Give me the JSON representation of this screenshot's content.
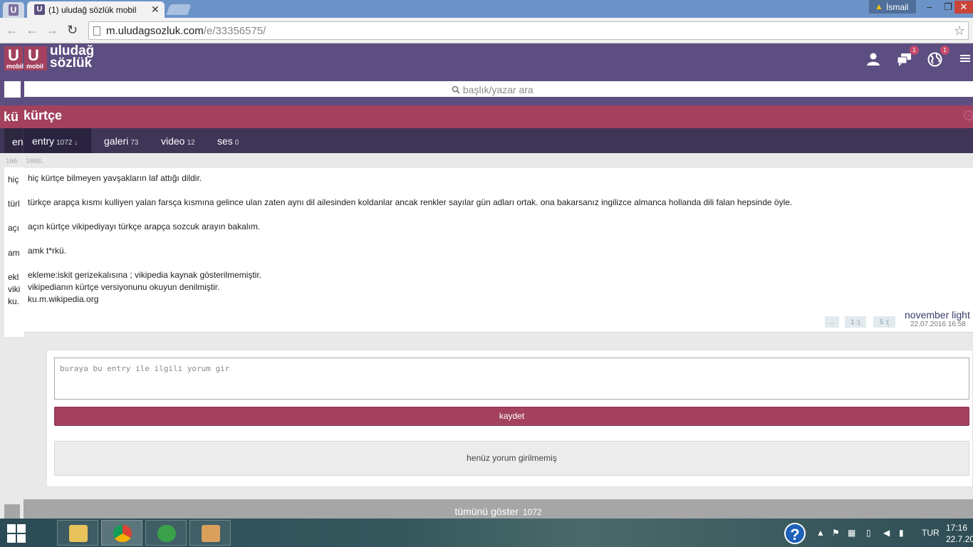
{
  "browser": {
    "tab_title": "(1) uludağ sözlük mobil",
    "tab_close": "✕",
    "user": "İsmail",
    "url_host": "m.uludagsozluk.com",
    "url_path": "/e/33356575/"
  },
  "header": {
    "logo_u": "U",
    "logo_mobil": "mobil",
    "logo_line1": "uludağ",
    "logo_line2": "sözlük",
    "messages_badge": "1",
    "notifications_badge": "1"
  },
  "search": {
    "placeholder": "başlık/yazar ara"
  },
  "topic": {
    "title": "kürtçe",
    "title_behind": "kü",
    "tabs": [
      {
        "label": "entry",
        "count": "1072 ↓"
      },
      {
        "label": "galeri",
        "count": "73"
      },
      {
        "label": "video",
        "count": "12"
      },
      {
        "label": "ses",
        "count": "0"
      }
    ],
    "tab_behind": "en"
  },
  "back_entry": {
    "number": "106",
    "lines": [
      "hiç",
      "türl",
      "açı",
      "am",
      "ekl",
      "viki",
      "ku."
    ]
  },
  "entry": {
    "number": "1068.",
    "lines": [
      "hiç kürtçe bilmeyen yavşakların laf attığı dildir.",
      "türkçe arapça kısmı kulliyen yalan farsça kısmına gelince ulan zaten aynı dil ailesinden koldanlar ancak renkler sayılar gün adları ortak. ona bakarsanız ingilizce almanca hollanda dili falan hepsinde öyle.",
      "açın kürtçe vikipediyayı türkçe arapça sozcuk arayın bakalım.",
      "amk t*rkü.",
      "ekleme:iskit gerizekalısına ; vikipedia kaynak gösterilmemiştir.",
      "vikipedianın kürtçe versiyonunu okuyun denilmiştir.",
      "ku.m.wikipedia.org"
    ],
    "vote_more": "...",
    "vote_up": "1 :)",
    "vote_down": "5 :(",
    "author": "november light",
    "date": "22.07.2016 16:58"
  },
  "comment": {
    "placeholder": "buraya bu entry ile ilgili yorum gir",
    "save": "kaydet",
    "empty": "henüz yorum girilmemiş"
  },
  "show_all": {
    "label": "tümünü göster",
    "count": "1072"
  },
  "taskbar": {
    "language": "TUR",
    "time": "17:16",
    "date": "22.7.20"
  },
  "colors": {
    "header": "#5c4e80",
    "topic_bar": "#a3415f",
    "tab_bar": "#3f3557",
    "accent": "#a3415f"
  },
  "icons": {
    "user": "user-icon",
    "messages": "messages-icon",
    "globe": "globe-icon",
    "menu": "menu-icon",
    "gear": "gear-icon",
    "search": "search-icon"
  }
}
